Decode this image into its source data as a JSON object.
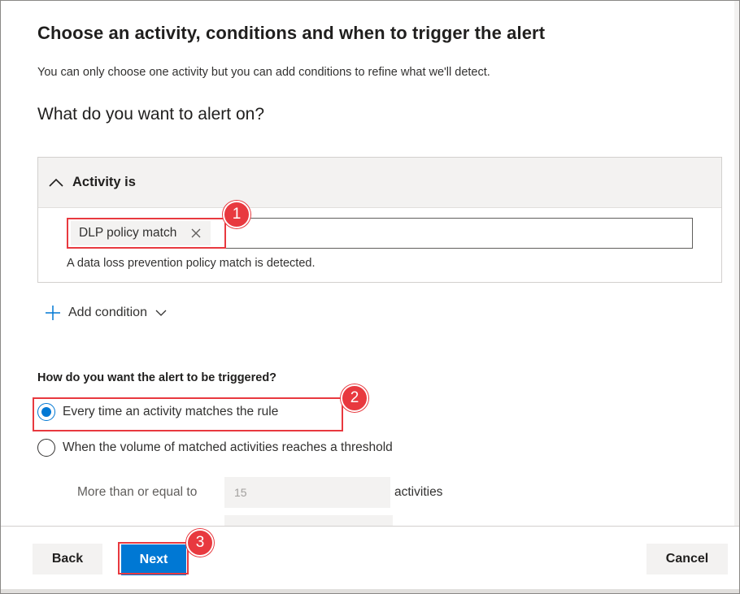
{
  "page": {
    "title": "Choose an activity, conditions and when to trigger the alert",
    "subtitle": "You can only choose one activity but you can add conditions to refine what we'll detect.",
    "section_heading": "What do you want to alert on?"
  },
  "activity_accordion": {
    "header": "Activity is",
    "chevron_icon": "chevron-up-icon",
    "selected_tag": "DLP policy match",
    "remove_icon": "close-icon",
    "description": "A data loss prevention policy match is detected."
  },
  "add_condition": {
    "label": "Add condition",
    "plus_icon": "plus-icon",
    "chevron_icon": "chevron-down-icon"
  },
  "trigger": {
    "label": "How do you want the alert to be triggered?",
    "options": [
      {
        "label": "Every time an activity matches the rule",
        "checked": true
      },
      {
        "label": "When the volume of matched activities reaches a threshold",
        "checked": false
      }
    ],
    "threshold_label": "More than or equal to",
    "threshold_value": "15",
    "threshold_unit": "activities"
  },
  "footer": {
    "back_label": "Back",
    "next_label": "Next",
    "cancel_label": "Cancel"
  },
  "annotations": {
    "badges": [
      "1",
      "2",
      "3"
    ],
    "color": "#e8393f"
  },
  "colors": {
    "accent": "#0078d4",
    "annotation": "#e8393f"
  }
}
